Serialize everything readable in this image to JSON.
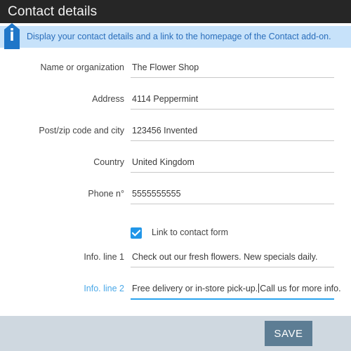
{
  "window": {
    "title": "Contact details"
  },
  "banner": {
    "icon": "info-badge-icon",
    "message": "Display your contact details and a link to the homepage of the Contact add-on."
  },
  "form": {
    "fields": [
      {
        "label": "Name or organization",
        "value": "The Flower Shop",
        "focused": false
      },
      {
        "label": "Address",
        "value": "4114 Peppermint",
        "focused": false
      },
      {
        "label": "Post/zip code and city",
        "value": "123456 Invented",
        "focused": false
      },
      {
        "label": "Country",
        "value": "United Kingdom",
        "focused": false
      },
      {
        "label": "Phone n°",
        "value": "5555555555",
        "focused": false
      }
    ],
    "checkbox": {
      "label": "Link to contact form",
      "checked": true,
      "icon": "checkmark-icon"
    },
    "info_line_1": {
      "label": "Info. line 1",
      "value": "Check out our fresh flowers. New specials daily.",
      "focused": false
    },
    "info_line_2": {
      "label": "Info. line 2",
      "value_before_caret": "Free delivery or in-store pick-up.",
      "value_after_caret": "Call us for more info.",
      "focused": true
    }
  },
  "footer": {
    "save_label": "SAVE"
  },
  "colors": {
    "titlebar_bg": "#262626",
    "banner_bg": "#c7e2fa",
    "banner_text": "#2a6ebb",
    "accent_blue": "#29a3ef",
    "checkbox_blue": "#2196e8",
    "focused_label": "#4aa8e8",
    "footer_bg": "#cfd8e0",
    "save_button_bg": "#5d7d94"
  }
}
